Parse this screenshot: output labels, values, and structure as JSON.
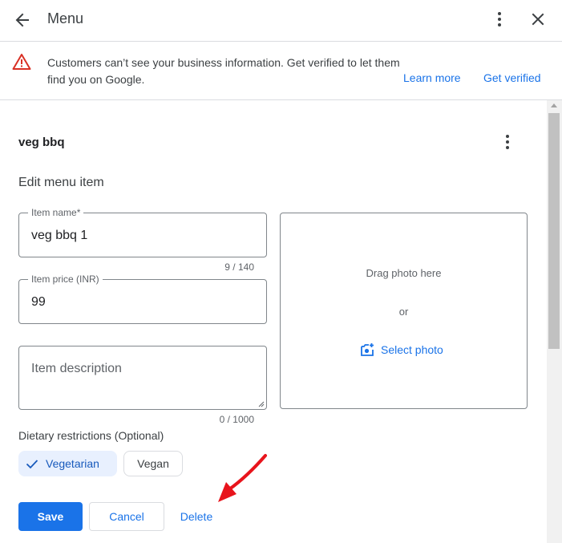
{
  "header": {
    "title": "Menu",
    "back_icon": "arrow-back-icon",
    "more_icon": "more-vert-icon",
    "close_icon": "close-icon"
  },
  "banner": {
    "message": "Customers can’t see your business information. Get verified to let them find you on Google.",
    "learn_more": "Learn more",
    "get_verified": "Get verified",
    "warning_color": "#d93025"
  },
  "item": {
    "title": "veg bbq"
  },
  "form": {
    "section_title": "Edit menu item",
    "name": {
      "label": "Item name*",
      "value": "veg bbq 1",
      "counter": "9 / 140"
    },
    "price": {
      "label": "Item price (INR)",
      "value": "99"
    },
    "description": {
      "placeholder": "Item description",
      "counter": "0 / 1000"
    },
    "photo": {
      "drag_text": "Drag photo here",
      "or_text": "or",
      "select_label": "Select photo"
    },
    "dietary": {
      "label": "Dietary restrictions (Optional)",
      "options": [
        {
          "label": "Vegetarian",
          "selected": true
        },
        {
          "label": "Vegan",
          "selected": false
        }
      ]
    }
  },
  "actions": {
    "save": "Save",
    "cancel": "Cancel",
    "delete": "Delete"
  },
  "colors": {
    "accent": "#1a73e8",
    "annotation_arrow": "#e8141c"
  }
}
